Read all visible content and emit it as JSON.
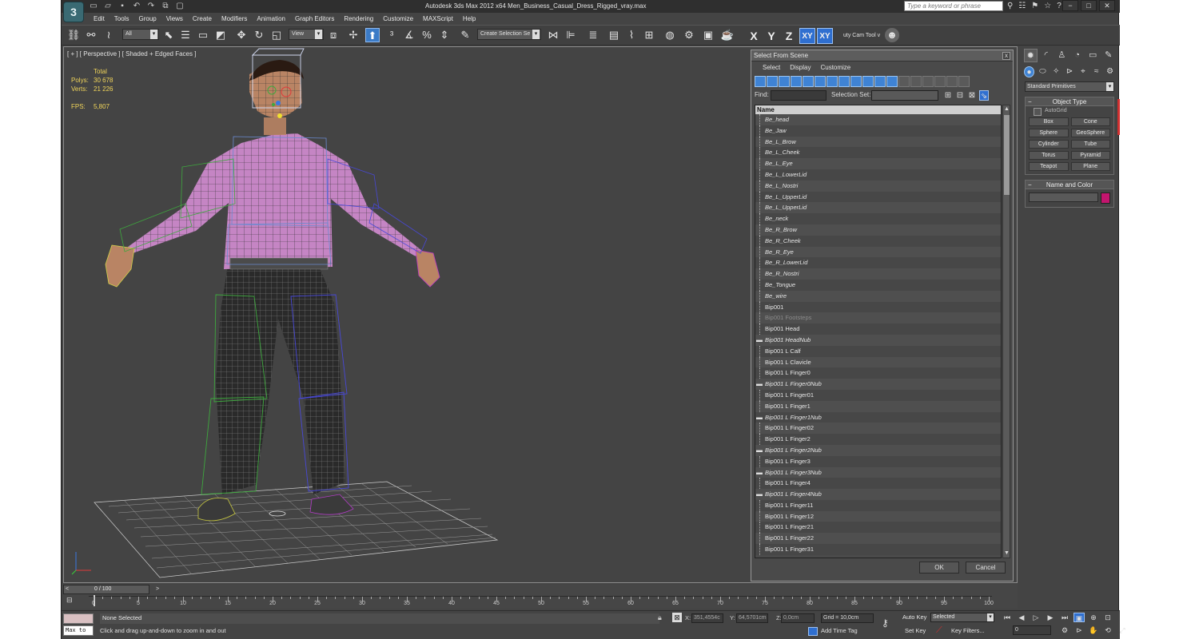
{
  "window": {
    "title": "Autodesk 3ds Max  2012 x64      Men_Business_Casual_Dress_Rigged_vray.max",
    "app_logo": "3",
    "search_placeholder": "Type a keyword or phrase",
    "minimize": "−",
    "maximize": "□",
    "close": "✕"
  },
  "menu": [
    "Edit",
    "Tools",
    "Group",
    "Views",
    "Create",
    "Modifiers",
    "Animation",
    "Graph Editors",
    "Rendering",
    "Customize",
    "MAXScript",
    "Help"
  ],
  "toolbar": {
    "filter": "All",
    "ref_coord": "View",
    "selection_set": "Create Selection Se",
    "axes": [
      "X",
      "Y",
      "Z",
      "XY",
      "XY"
    ],
    "script_label": "uty Cam Tool v"
  },
  "viewport": {
    "label": "[ + ] [ Perspective ] [ Shaded + Edged Faces ]",
    "stats_header": "Total",
    "polys_label": "Polys:",
    "polys_value": "30 678",
    "verts_label": "Verts:",
    "verts_value": "21 226",
    "fps_label": "FPS:",
    "fps_value": "5,807"
  },
  "dialog": {
    "title": "Select From Scene",
    "close": "x",
    "menu": [
      "Select",
      "Display",
      "Customize"
    ],
    "find_label": "Find:",
    "selection_set_label": "Selection Set:",
    "column_header": "Name",
    "items": [
      {
        "name": "Be_head",
        "style": "italic"
      },
      {
        "name": "Be_Jaw",
        "style": "italic"
      },
      {
        "name": "Be_L_Brow",
        "style": "italic"
      },
      {
        "name": "Be_L_Cheek",
        "style": "italic"
      },
      {
        "name": "Be_L_Eye",
        "style": "italic"
      },
      {
        "name": "Be_L_LowerLid",
        "style": "italic"
      },
      {
        "name": "Be_L_Nostri",
        "style": "italic"
      },
      {
        "name": "Be_L_UpperLid",
        "style": "italic"
      },
      {
        "name": "Be_L_UpperLid",
        "style": "italic"
      },
      {
        "name": "Be_neck",
        "style": "italic"
      },
      {
        "name": "Be_R_Brow",
        "style": "italic"
      },
      {
        "name": "Be_R_Cheek",
        "style": "italic"
      },
      {
        "name": "Be_R_Eye",
        "style": "italic"
      },
      {
        "name": "Be_R_LowerLid",
        "style": "italic"
      },
      {
        "name": "Be_R_Nostri",
        "style": "italic"
      },
      {
        "name": "Be_Tongue",
        "style": "italic"
      },
      {
        "name": "Be_wire",
        "style": "italic"
      },
      {
        "name": "Bip001",
        "style": "normal"
      },
      {
        "name": "Bip001 Footsteps",
        "style": "dim"
      },
      {
        "name": "Bip001 Head",
        "style": "normal"
      },
      {
        "name": "Bip001 HeadNub",
        "style": "italic",
        "bone": true
      },
      {
        "name": "Bip001 L Calf",
        "style": "normal"
      },
      {
        "name": "Bip001 L Clavicle",
        "style": "normal"
      },
      {
        "name": "Bip001 L Finger0",
        "style": "normal"
      },
      {
        "name": "Bip001 L Finger0Nub",
        "style": "italic",
        "bone": true
      },
      {
        "name": "Bip001 L Finger01",
        "style": "normal"
      },
      {
        "name": "Bip001 L Finger1",
        "style": "normal"
      },
      {
        "name": "Bip001 L Finger1Nub",
        "style": "italic",
        "bone": true
      },
      {
        "name": "Bip001 L Finger02",
        "style": "normal"
      },
      {
        "name": "Bip001 L Finger2",
        "style": "normal"
      },
      {
        "name": "Bip001 L Finger2Nub",
        "style": "italic",
        "bone": true
      },
      {
        "name": "Bip001 L Finger3",
        "style": "normal"
      },
      {
        "name": "Bip001 L Finger3Nub",
        "style": "italic",
        "bone": true
      },
      {
        "name": "Bip001 L Finger4",
        "style": "normal"
      },
      {
        "name": "Bip001 L Finger4Nub",
        "style": "italic",
        "bone": true
      },
      {
        "name": "Bip001 L Finger11",
        "style": "normal"
      },
      {
        "name": "Bip001 L Finger12",
        "style": "normal"
      },
      {
        "name": "Bip001 L Finger21",
        "style": "normal"
      },
      {
        "name": "Bip001 L Finger22",
        "style": "normal"
      },
      {
        "name": "Bip001 L Finger31",
        "style": "normal"
      }
    ],
    "ok": "OK",
    "cancel": "Cancel"
  },
  "command_panel": {
    "category": "Standard Primitives",
    "object_type_title": "Object Type",
    "autogrid": "AutoGrid",
    "objects": [
      "Box",
      "Cone",
      "Sphere",
      "GeoSphere",
      "Cylinder",
      "Tube",
      "Torus",
      "Pyramid",
      "Teapot",
      "Plane"
    ],
    "name_color_title": "Name and Color",
    "object_color": "#c3156e"
  },
  "timeline": {
    "slider_value": "0 / 100",
    "ticks": [
      "0",
      "5",
      "10",
      "15",
      "20",
      "25",
      "30",
      "35",
      "40",
      "45",
      "50",
      "55",
      "60",
      "65",
      "70",
      "75",
      "80",
      "85",
      "90",
      "95",
      "100"
    ]
  },
  "status": {
    "listener_label": "Max to",
    "selection": "None Selected",
    "prompt": "Click and drag up-and-down to zoom in and out",
    "x_label": "X:",
    "x_value": "351,4554c",
    "y_label": "Y:",
    "y_value": "64,5701cm",
    "z_label": "Z:",
    "z_value": "0,0cm",
    "grid": "Grid = 10,0cm",
    "add_time_tag": "Add Time Tag",
    "auto_key": "Auto Key",
    "set_key": "Set Key",
    "key_mode": "Selected",
    "key_filters": "Key Filters...",
    "frame": "0"
  }
}
